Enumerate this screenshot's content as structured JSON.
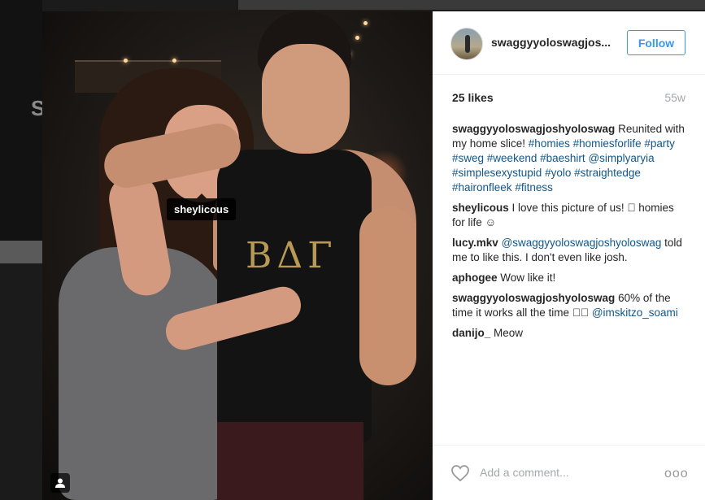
{
  "background": {
    "partial_text": "S"
  },
  "photo": {
    "shirt_letters": "ΒΔΓ",
    "tag_tooltip": "sheylicous",
    "user_icon": "user-icon"
  },
  "post": {
    "username": "swaggyyoloswagjos...",
    "follow_label": "Follow",
    "likes": "25 likes",
    "time": "55w",
    "add_comment_placeholder": "Add a comment...",
    "more_label": "ooo"
  },
  "comments": [
    {
      "user": "swaggyyoloswagjoshyoloswag",
      "text": "Reunited with my home slice!",
      "tags": [
        "#homies",
        "#homiesforlife",
        "#party",
        "#sweg",
        "#weekend",
        "#baeshirt",
        "@simplyaryia",
        "#simplesexystupid",
        "#yolo",
        "#straightedge",
        "#haironfleek",
        "#fitness"
      ]
    },
    {
      "user": "sheylicous",
      "text": "I love this picture of us! 􀀀 homies for life ☺"
    },
    {
      "user": "lucy.mkv",
      "mention": "@swaggyyoloswagjoshyoloswag",
      "text": "told me to like this. I don't even like josh."
    },
    {
      "user": "aphogee",
      "text": "Wow like it!"
    },
    {
      "user": "swaggyyoloswagjoshyoloswag",
      "text": "60% of the time it works all the time 􀀀􀀀",
      "mention": "@imskitzo_soami"
    },
    {
      "user": "danijo_",
      "text": "Meow"
    }
  ],
  "colors": {
    "link": "#125688",
    "follow": "#3897f0",
    "muted": "#a5a7aa",
    "text": "#262626"
  }
}
